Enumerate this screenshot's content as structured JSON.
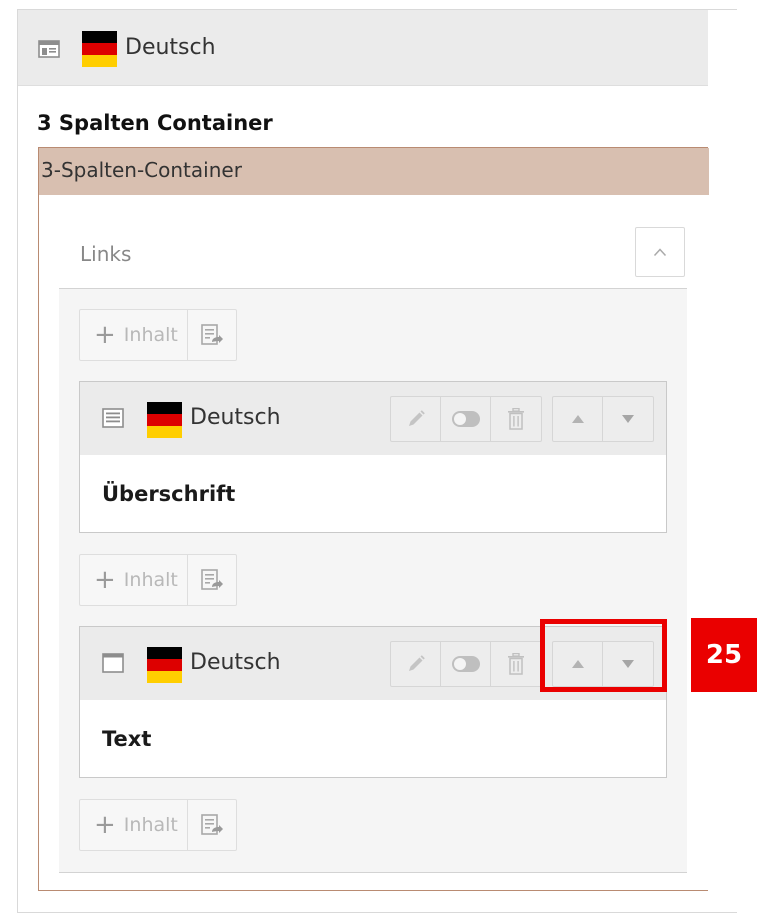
{
  "page": {
    "language": "Deutsch",
    "title": "3 Spalten Container"
  },
  "grid": {
    "header": "3-Spalten-Container",
    "column": {
      "label": "Links",
      "new_content_label": "Inhalt",
      "elements": [
        {
          "language": "Deutsch",
          "body": "Überschrift",
          "type_icon": "header-content-icon"
        },
        {
          "language": "Deutsch",
          "body": "Text",
          "type_icon": "text-content-icon"
        }
      ]
    }
  },
  "annotation": {
    "badge": "25",
    "highlight_color": "#ea0000"
  },
  "colors": {
    "header_bg": "#ebebeb",
    "grid_header_bg": "#d8bfb0",
    "grid_border": "#b98b72",
    "highlight": "#ea0000"
  }
}
